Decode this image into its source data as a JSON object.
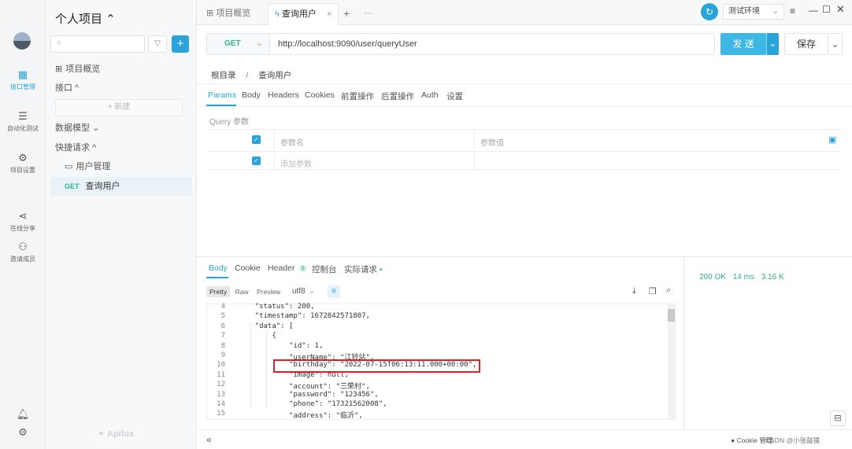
{
  "rail": {
    "items": [
      {
        "label": "接口管理",
        "icon": "api-icon"
      },
      {
        "label": "自动化测试",
        "icon": "test-icon"
      },
      {
        "label": "项目设置",
        "icon": "settings-icon"
      },
      {
        "label": "在线分享",
        "icon": "share-icon"
      },
      {
        "label": "邀请成员",
        "icon": "invite-icon"
      }
    ]
  },
  "project": {
    "title": "个人项目 ⌃",
    "search_placeholder": "",
    "overview": "项目概览",
    "interface_section": "接口 ^",
    "new_label": "+ 新建",
    "data_model": "数据模型 ⌄",
    "quick_request": "快捷请求 ^",
    "folder": "用户管理",
    "request_method": "GET",
    "request_name": "查询用户",
    "brand": "Apifox"
  },
  "tabs": {
    "overview": "项目概览",
    "current": "查询用户",
    "plus": "+",
    "more": "···",
    "env": "测试环境"
  },
  "request": {
    "method": "GET",
    "url": "http://localhost:9090/user/queryUser",
    "send": "发 送",
    "save": "保存",
    "breadcrumb_root": "根目录",
    "breadcrumb_sep": "/",
    "breadcrumb_current": "查询用户",
    "subtabs": [
      "Params",
      "Body",
      "Headers",
      "Cookies",
      "前置操作",
      "后置操作",
      "Auth",
      "设置"
    ],
    "query_title": "Query 参数",
    "col_name": "参数名",
    "col_value": "参数值",
    "add_param": "添加参数"
  },
  "response": {
    "tabs": [
      "Body",
      "Cookie",
      "Header",
      "控制台",
      "实际请求"
    ],
    "header_count": "8",
    "views": [
      "Pretty",
      "Raw",
      "Preview"
    ],
    "encoding": "utf8",
    "status": "200 OK",
    "time": "14 ms",
    "size": "3.16 K",
    "lines": [
      {
        "n": "4",
        "text": "    \"status\": 200,"
      },
      {
        "n": "5",
        "text": "    \"timestamp\": 1672842571807,"
      },
      {
        "n": "6",
        "text": "    \"data\": ["
      },
      {
        "n": "7",
        "text": "        {"
      },
      {
        "n": "8",
        "text": "            \"id\": 1,"
      },
      {
        "n": "9",
        "text": "            \"userName\": \"江铃站\","
      },
      {
        "n": "10",
        "text": "            \"birthday\": \"2022-07-15T06:13:11.000+00:00\","
      },
      {
        "n": "11",
        "text": "            \"image\": null,"
      },
      {
        "n": "12",
        "text": "            \"account\": \"三荣村\","
      },
      {
        "n": "13",
        "text": "            \"password\": \"123456\","
      },
      {
        "n": "14",
        "text": "            \"phone\": \"17321562008\","
      },
      {
        "n": "15",
        "text": "            \"address\": \"临沂\","
      }
    ]
  },
  "footer": {
    "cookie": "Cookie 管理",
    "watermark": "CSDN @小张敲猿"
  },
  "colors": {
    "accent": "#2aa4d8",
    "get": "#2eb58b",
    "highlight": "#d9222a"
  }
}
